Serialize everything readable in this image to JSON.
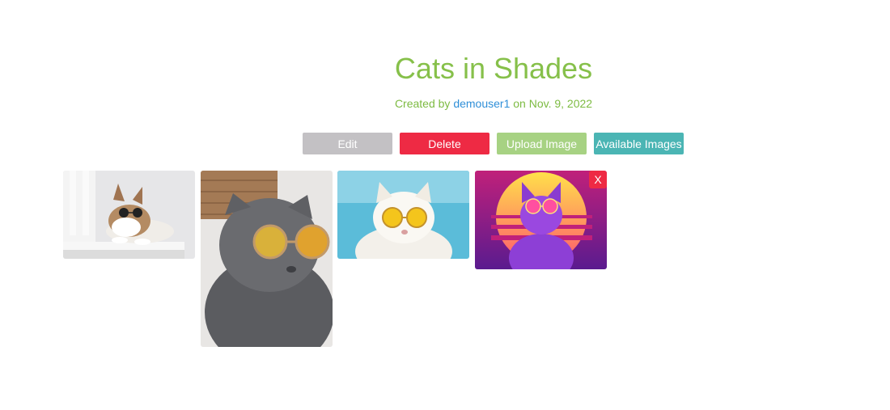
{
  "page": {
    "title": "Cats in Shades",
    "byline_prefix": "Created by",
    "author": "demouser1",
    "byline_suffix": "on Nov. 9, 2022"
  },
  "actions": {
    "edit_label": "Edit",
    "delete_label": "Delete",
    "upload_label": "Upload Image",
    "available_label": "Available Images"
  },
  "gallery": {
    "remove_label": "X"
  },
  "colors": {
    "title": "#86c04a",
    "link": "#2f8fd8",
    "edit": "#c3c1c4",
    "delete": "#ee2a44",
    "upload": "#a7d283",
    "available": "#4bb5b4"
  }
}
